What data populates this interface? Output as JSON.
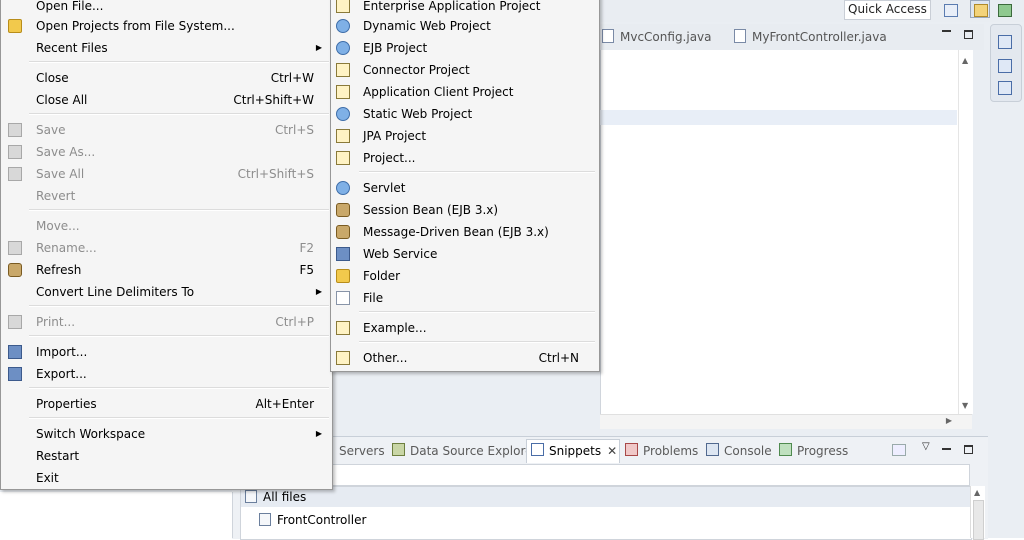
{
  "toolbar": {
    "quick_access": "Quick Access"
  },
  "editor_tabs": [
    {
      "label": "MvcConfig.java"
    },
    {
      "label": "MyFrontController.java"
    }
  ],
  "bottom_tabs": [
    {
      "label": "Servers"
    },
    {
      "label": "Data Source Explorer"
    },
    {
      "label": "Snippets"
    },
    {
      "label": "Problems"
    },
    {
      "label": "Console"
    },
    {
      "label": "Progress"
    }
  ],
  "snippets": {
    "root": "All files",
    "items": [
      "FrontController"
    ]
  },
  "file_menu": {
    "items": [
      {
        "label": "Open File...",
        "accel": ""
      },
      {
        "label": "Open Projects from File System...",
        "accel": ""
      },
      {
        "label": "Recent Files",
        "accel": ""
      },
      {
        "label": "Close",
        "accel": "Ctrl+W"
      },
      {
        "label": "Close All",
        "accel": "Ctrl+Shift+W"
      },
      {
        "label": "Save",
        "accel": "Ctrl+S"
      },
      {
        "label": "Save As...",
        "accel": ""
      },
      {
        "label": "Save All",
        "accel": "Ctrl+Shift+S"
      },
      {
        "label": "Revert",
        "accel": ""
      },
      {
        "label": "Move...",
        "accel": ""
      },
      {
        "label": "Rename...",
        "accel": "F2"
      },
      {
        "label": "Refresh",
        "accel": "F5"
      },
      {
        "label": "Convert Line Delimiters To",
        "accel": ""
      },
      {
        "label": "Print...",
        "accel": "Ctrl+P"
      },
      {
        "label": "Import...",
        "accel": ""
      },
      {
        "label": "Export...",
        "accel": ""
      },
      {
        "label": "Properties",
        "accel": "Alt+Enter"
      },
      {
        "label": "Switch Workspace",
        "accel": ""
      },
      {
        "label": "Restart",
        "accel": ""
      },
      {
        "label": "Exit",
        "accel": ""
      }
    ]
  },
  "new_menu": {
    "items": [
      {
        "label": "Enterprise Application Project",
        "accel": ""
      },
      {
        "label": "Dynamic Web Project",
        "accel": ""
      },
      {
        "label": "EJB Project",
        "accel": ""
      },
      {
        "label": "Connector Project",
        "accel": ""
      },
      {
        "label": "Application Client Project",
        "accel": ""
      },
      {
        "label": "Static Web Project",
        "accel": ""
      },
      {
        "label": "JPA Project",
        "accel": ""
      },
      {
        "label": "Project...",
        "accel": ""
      },
      {
        "label": "Servlet",
        "accel": ""
      },
      {
        "label": "Session Bean (EJB 3.x)",
        "accel": ""
      },
      {
        "label": "Message-Driven Bean (EJB 3.x)",
        "accel": ""
      },
      {
        "label": "Web Service",
        "accel": ""
      },
      {
        "label": "Folder",
        "accel": ""
      },
      {
        "label": "File",
        "accel": ""
      },
      {
        "label": "Example...",
        "accel": ""
      },
      {
        "label": "Other...",
        "accel": "Ctrl+N"
      }
    ]
  }
}
